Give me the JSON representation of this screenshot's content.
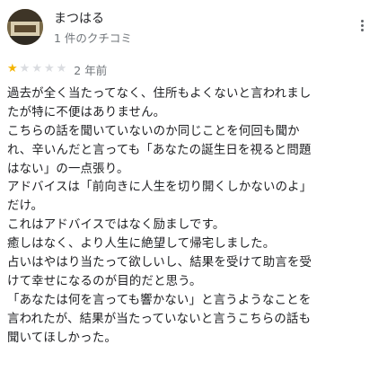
{
  "review": {
    "author": "まつはる",
    "author_meta": "1 件のクチコミ",
    "rating": 1,
    "rating_max": 5,
    "date": "2 年前",
    "lines": [
      "過去が全く当たってなく、住所もよくないと言われまし",
      "たが特に不便はありません。",
      "こちらの話を聞いていないのか同じことを何回も聞か",
      "れ、辛いんだと言っても「あなたの誕生日を視ると問題",
      "はない」の一点張り。",
      "アドバイスは「前向きに人生を切り開くしかないのよ」",
      "だけ。",
      "これはアドバイスではなく励ましです。",
      "癒しはなく、より人生に絶望して帰宅しました。",
      "占いはやはり当たって欲しいし、結果を受けて助言を受",
      "けて幸せになるのが目的だと思う。",
      "「あなたは何を言っても響かない」と言うようなことを",
      "言われたが、結果が当たっていないと言うこちらの話も",
      "聞いてほしかった。"
    ]
  },
  "icons": {
    "more": "more-vert-icon",
    "star_filled": "star-filled-icon",
    "star_empty": "star-empty-icon"
  },
  "colors": {
    "star_on": "#f4b400",
    "star_off": "#dadce0",
    "meta_text": "#70757a"
  }
}
